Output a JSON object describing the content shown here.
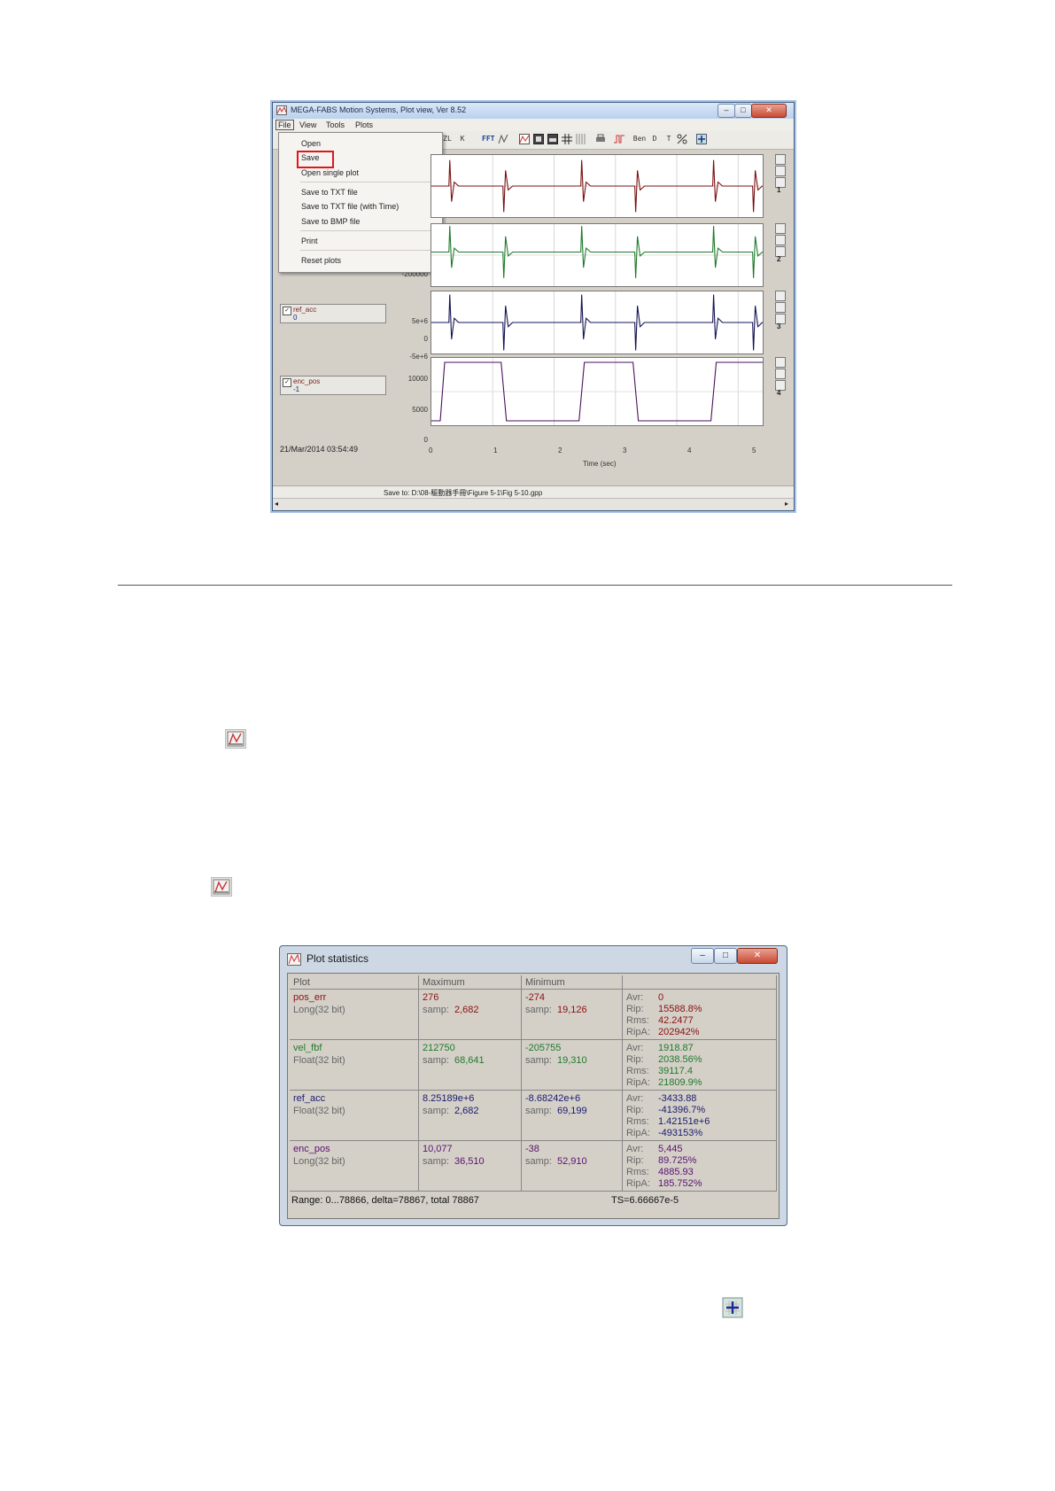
{
  "plot_window": {
    "title": "MEGA-FABS Motion Systems, Plot view, Ver 8.52",
    "title_buttons": [
      "–",
      "□",
      "✕"
    ],
    "menu": [
      "File",
      "View",
      "Tools",
      "Plots"
    ],
    "toolbar_labels": [
      "ZL",
      "K",
      "FFT",
      "Ben",
      "D",
      "T"
    ],
    "file_menu": {
      "items": [
        "Open",
        "Save",
        "Open single plot",
        "Save to TXT file",
        "Save to TXT file (with Time)",
        "Save to BMP file",
        "Print",
        "Reset plots"
      ],
      "highlighted": "Save",
      "highlight_color": "#e0161b"
    },
    "signals": [
      {
        "name": "ref_acc",
        "value": "0"
      },
      {
        "name": "enc_pos",
        "value": "-1"
      }
    ],
    "trace_numbers": [
      "1",
      "2",
      "3",
      "4"
    ],
    "trace_colors": [
      "#7a1010",
      "#1f7a2a",
      "#141455",
      "#4a0f5a"
    ],
    "y_labels": {
      "trace2": [
        "-200000"
      ],
      "trace3": [
        "5e+6",
        "0",
        "-5e+6"
      ],
      "trace4": [
        "10000",
        "5000",
        "0"
      ]
    },
    "x_ticks": [
      "0",
      "1",
      "2",
      "3",
      "4",
      "5"
    ],
    "x_label": "Time (sec)",
    "timestamp": "21/Mar/2014  03:54:49",
    "status": "Save to: D:\\08-驅動器手冊\\Figure 5-1\\Fig 5-10.gpp"
  },
  "stats_window": {
    "title": "Plot statistics",
    "title_buttons": [
      "–",
      "□",
      "✕"
    ],
    "headers": [
      "Plot",
      "Maximum",
      "Minimum",
      ""
    ],
    "samp_label": "samp:",
    "stat_labels": [
      "Avr:",
      "Rip:",
      "Rms:",
      "RipA:"
    ],
    "rows": [
      {
        "name": "pos_err",
        "type": "Long(32 bit)",
        "max": "276",
        "max_samp": "2,682",
        "min": "-274",
        "min_samp": "19,126",
        "avr": "0",
        "rip": "15588.8%",
        "rms": "42.2477",
        "ripa": "202942%",
        "color": "#8b1010"
      },
      {
        "name": "vel_fbf",
        "type": "Float(32 bit)",
        "max": "212750",
        "max_samp": "68,641",
        "min": "-205755",
        "min_samp": "19,310",
        "avr": "1918.87",
        "rip": "2038.56%",
        "rms": "39117.4",
        "ripa": "21809.9%",
        "color": "#1f7a2a"
      },
      {
        "name": "ref_acc",
        "type": "Float(32 bit)",
        "max": "8.25189e+6",
        "max_samp": "2,682",
        "min": "-8.68242e+6",
        "min_samp": "69,199",
        "avr": "-3433.88",
        "rip": "-41396.7%",
        "rms": "1.42151e+6",
        "ripa": "-493153%",
        "color": "#1a1a70"
      },
      {
        "name": "enc_pos",
        "type": "Long(32 bit)",
        "max": "10,077",
        "max_samp": "36,510",
        "min": "-38",
        "min_samp": "52,910",
        "avr": "5,445",
        "rip": "89.725%",
        "rms": "4885.93",
        "ripa": "185.752%",
        "color": "#5a1070"
      }
    ],
    "range": "Range: 0...78866, delta=78867, total 78867",
    "ts": "TS=6.66667e-5"
  }
}
